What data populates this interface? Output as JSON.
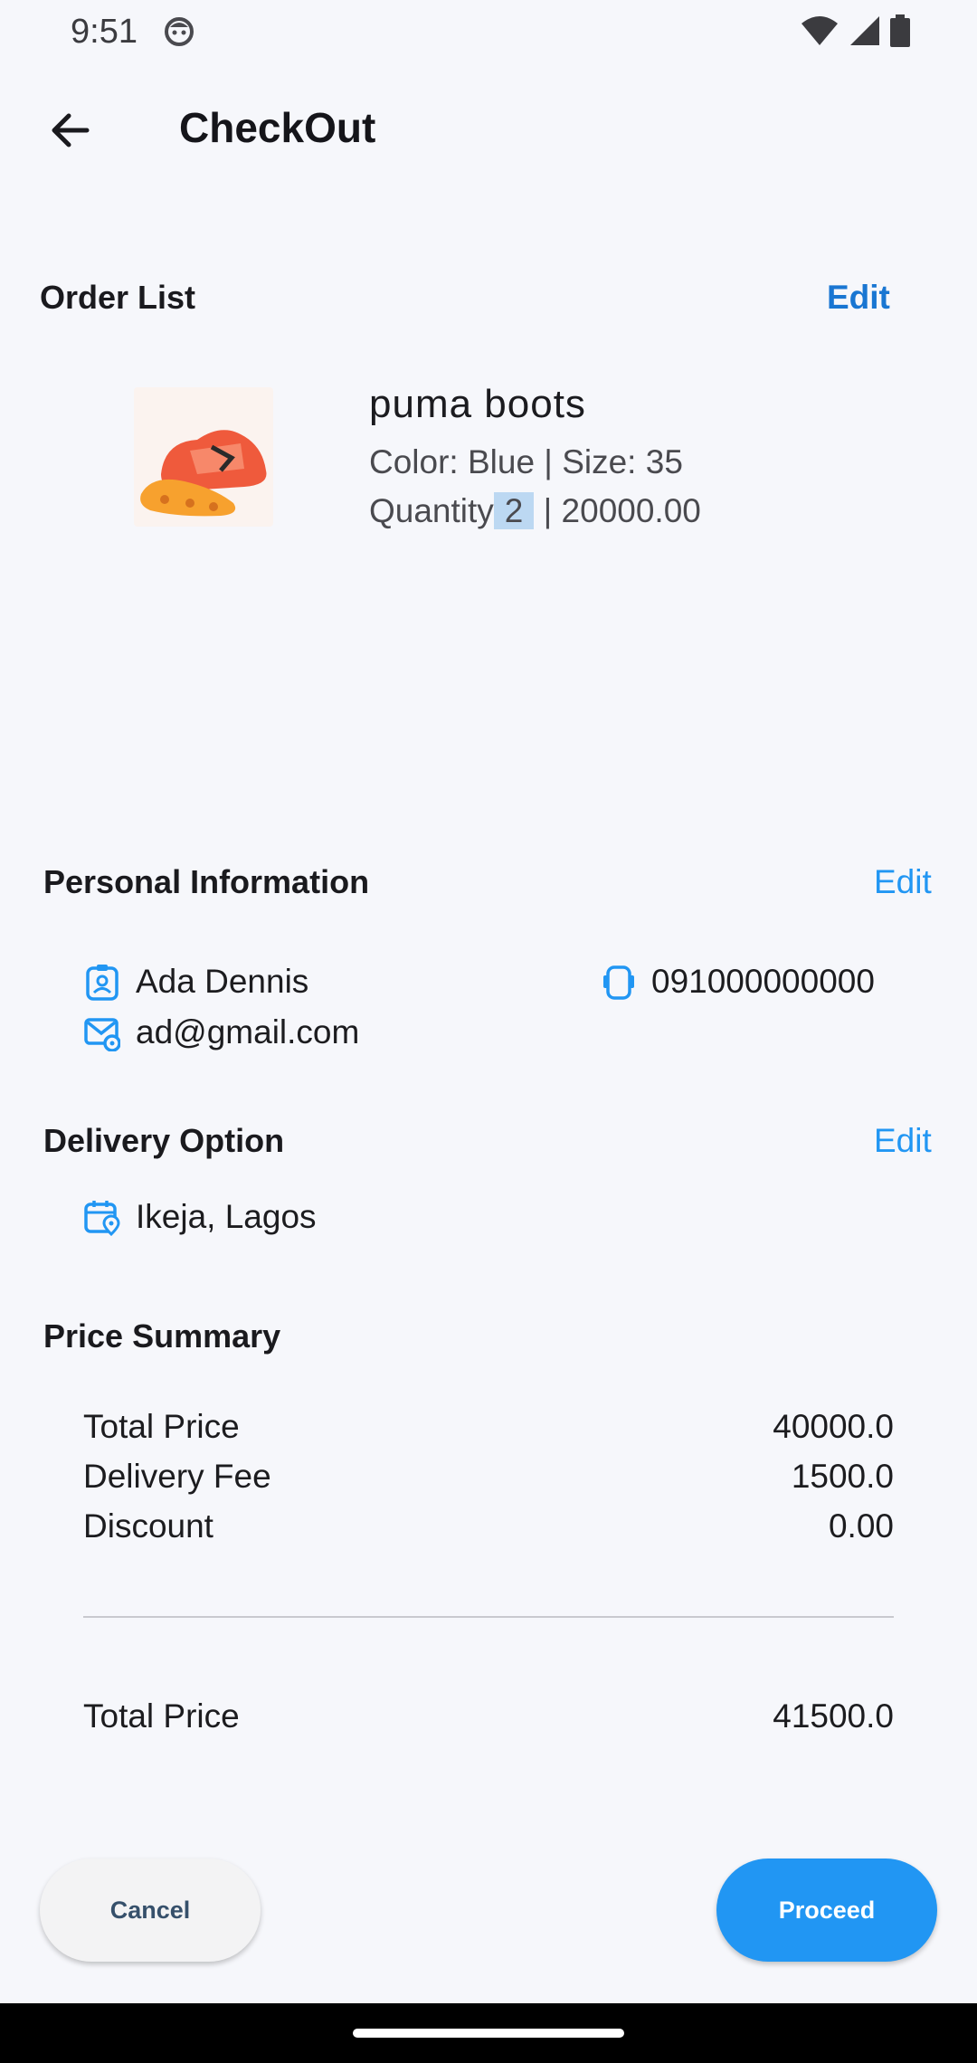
{
  "status_bar": {
    "time": "9:51"
  },
  "app_bar": {
    "title": "CheckOut"
  },
  "order_list": {
    "title": "Order List",
    "edit_label": "Edit",
    "item": {
      "name": "puma boots",
      "color_size": "Color: Blue | Size: 35",
      "quantity_label": "Quantity",
      "quantity": "2",
      "price": "| 20000.00"
    }
  },
  "personal_info": {
    "title": "Personal Information",
    "edit_label": "Edit",
    "name": "Ada Dennis",
    "phone": "091000000000",
    "email": "ad@gmail.com"
  },
  "delivery": {
    "title": "Delivery Option",
    "edit_label": "Edit",
    "location": "Ikeja, Lagos"
  },
  "price_summary": {
    "title": "Price Summary",
    "rows": [
      {
        "label": "Total Price",
        "value": "40000.0"
      },
      {
        "label": "Delivery Fee",
        "value": "1500.0"
      },
      {
        "label": "Discount",
        "value": "0.00"
      }
    ],
    "total": {
      "label": "Total Price",
      "value": "41500.0"
    }
  },
  "actions": {
    "cancel_label": "Cancel",
    "proceed_label": "Proceed"
  },
  "colors": {
    "accent": "#2196f3",
    "background": "#f6f7fb",
    "highlight": "#bcd8f2"
  }
}
